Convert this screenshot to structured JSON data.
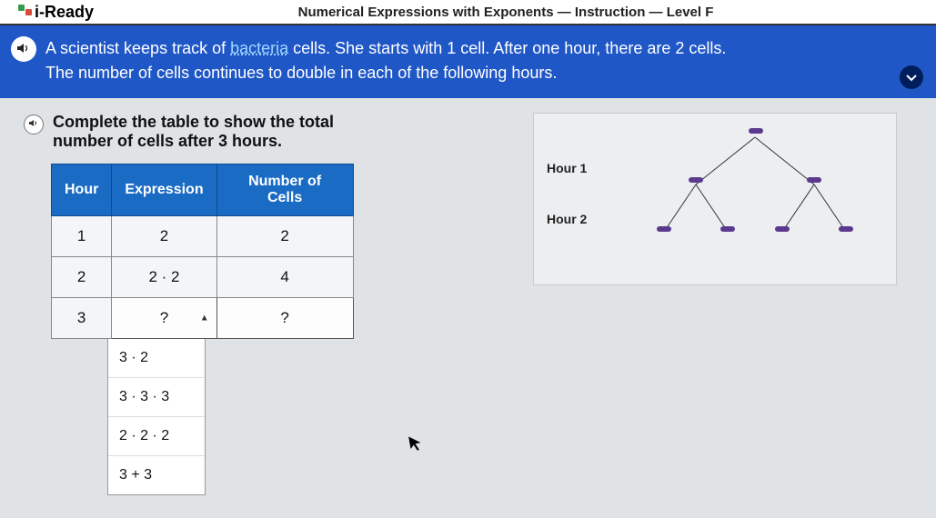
{
  "header": {
    "logo_text": "i-Ready",
    "breadcrumb": "Numerical Expressions with Exponents — Instruction — Level F"
  },
  "banner": {
    "line1_pre": "A scientist keeps track of ",
    "keyword": "bacteria",
    "line1_post": " cells. She starts with 1 cell. After one hour, there are 2 cells.",
    "line2": "The number of cells continues to double in each of the following hours."
  },
  "instruction": {
    "line1": "Complete the table to show the total",
    "line2": "number of cells after 3 hours."
  },
  "table": {
    "headers": {
      "hour": "Hour",
      "expr": "Expression",
      "num": "Number of Cells"
    },
    "rows": [
      {
        "hour": "1",
        "expr": "2",
        "num": "2"
      },
      {
        "hour": "2",
        "expr": "2 · 2",
        "num": "4"
      },
      {
        "hour": "3",
        "expr": "?",
        "num": "?"
      }
    ]
  },
  "options": [
    "3 · 2",
    "3 · 3 · 3",
    "2 · 2 · 2",
    "3 + 3"
  ],
  "diagram": {
    "label1": "Hour 1",
    "label2": "Hour 2"
  },
  "chart_data": {
    "type": "table",
    "title": "Bacteria cell count doubling each hour",
    "columns": [
      "Hour",
      "Expression",
      "Number of Cells"
    ],
    "rows": [
      [
        1,
        "2",
        2
      ],
      [
        2,
        "2·2",
        4
      ],
      [
        3,
        "?",
        "?"
      ]
    ],
    "dropdown_options": [
      "3·2",
      "3·3·3",
      "2·2·2",
      "3+3"
    ]
  }
}
